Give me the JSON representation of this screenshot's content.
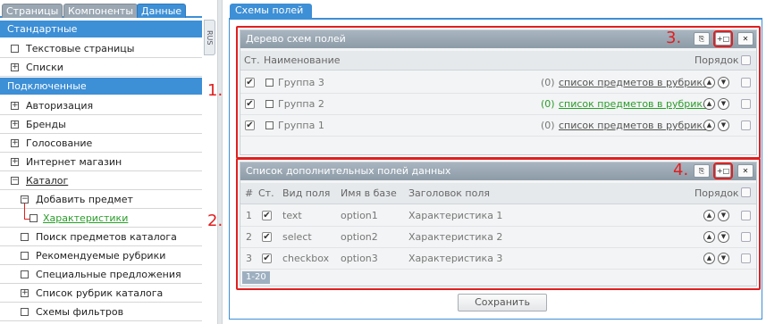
{
  "left": {
    "tabs": [
      "Страницы",
      "Компоненты",
      "Данные"
    ],
    "lang_tab": "RUS",
    "sections": {
      "standard": "Стандартные",
      "connected": "Подключенные"
    },
    "standard_items": [
      "Текстовые страницы",
      "Списки"
    ],
    "connected_items": [
      "Авторизация",
      "Бренды",
      "Голосование",
      "Интернет магазин",
      "Каталог",
      "Добавить предмет",
      "Характеристики",
      "Поиск предметов каталога",
      "Рекомендуемые рубрики",
      "Специальные предложения",
      "Список рубрик каталога",
      "Схемы фильтров"
    ]
  },
  "main": {
    "tab": "Схемы полей",
    "tree": {
      "title": "Дерево схем полей",
      "col_status": "Ст.",
      "col_name": "Наименование",
      "col_order": "Порядок",
      "link_text": "список предметов в рубрике",
      "rows": [
        {
          "name": "Группа 3",
          "count": "(0)",
          "highlight": false
        },
        {
          "name": "Группа 2",
          "count": "(0)",
          "highlight": true
        },
        {
          "name": "Группа 1",
          "count": "(0)",
          "highlight": false
        }
      ]
    },
    "fields": {
      "title": "Список дополнительных полей данных",
      "col_num": "#",
      "col_status": "Ст.",
      "col_type": "Вид поля",
      "col_dbname": "Имя в базе",
      "col_header": "Заголовок поля",
      "col_order": "Порядок",
      "rows": [
        {
          "num": "1",
          "type": "text",
          "db": "option1",
          "header": "Характеристика 1"
        },
        {
          "num": "2",
          "type": "select",
          "db": "option2",
          "header": "Характеристика 2"
        },
        {
          "num": "3",
          "type": "checkbox",
          "db": "option3",
          "header": "Характеристика 3"
        }
      ],
      "pager": "1-20"
    },
    "save_button": "Сохранить"
  },
  "annotations": {
    "label1": "1.",
    "label2": "2.",
    "label3": "3.",
    "label4": "4."
  },
  "colors": {
    "accent": "#3d8fd6",
    "highlight": "#e01f1f",
    "link_green": "#2a9d2a"
  }
}
